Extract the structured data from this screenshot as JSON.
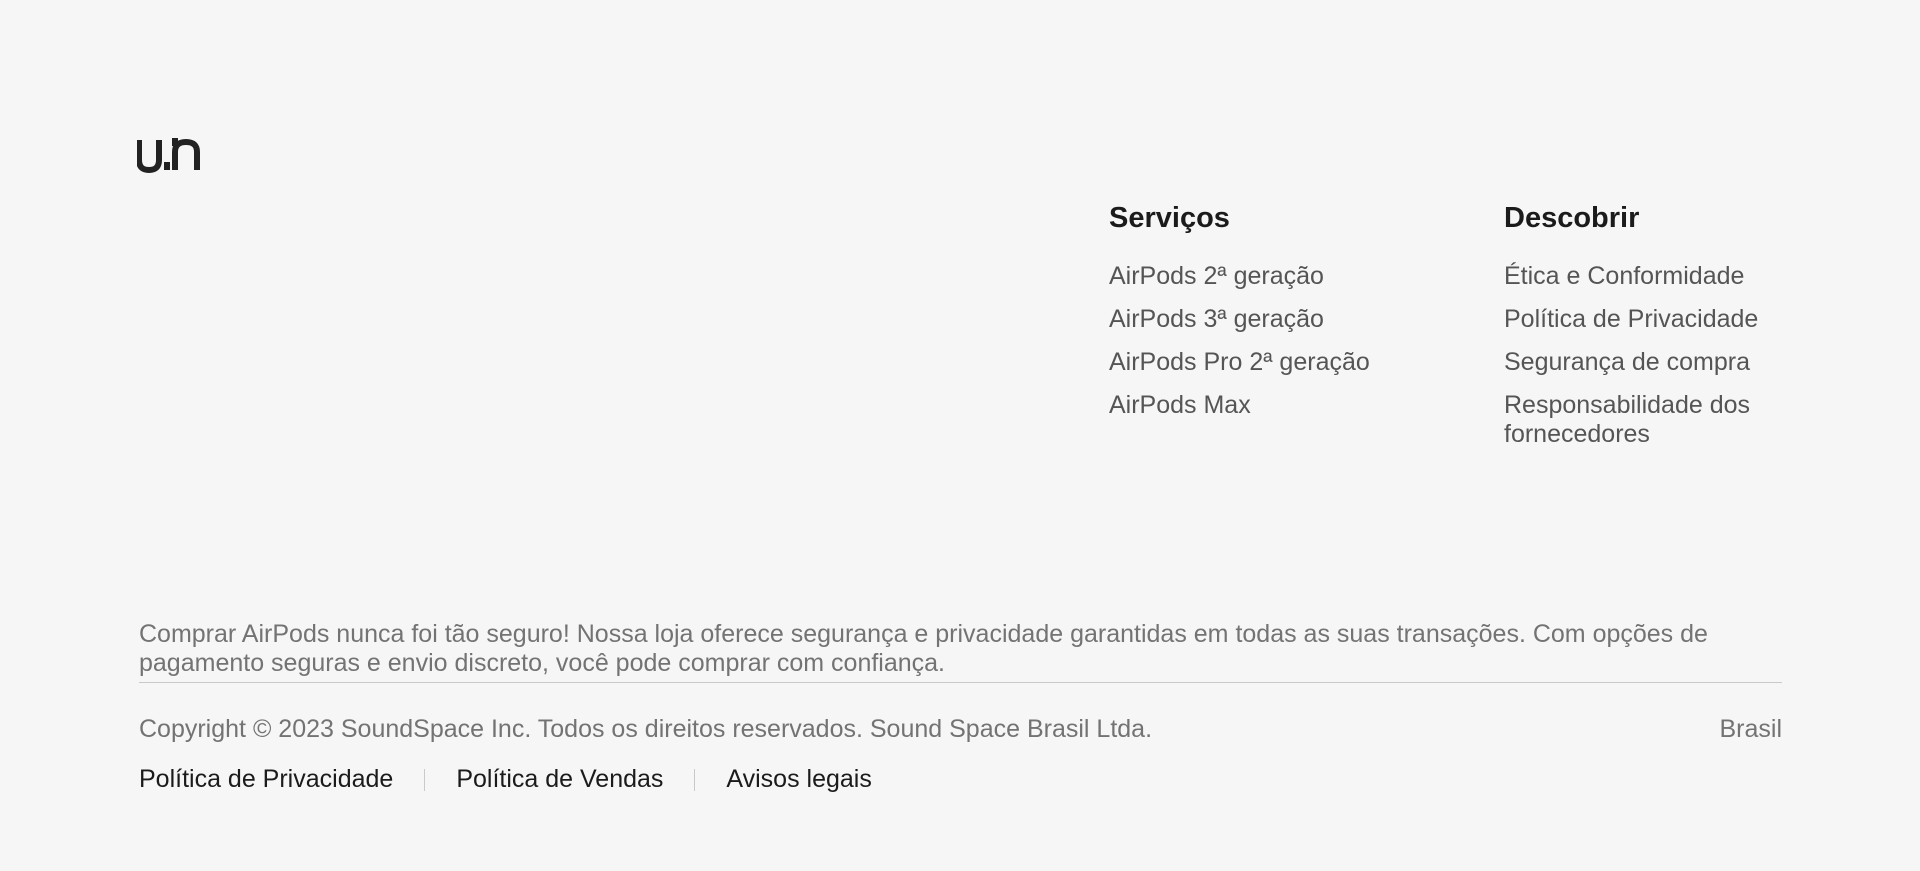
{
  "logo": {
    "alt": "un"
  },
  "columns": {
    "services": {
      "title": "Serviços",
      "items": [
        "AirPods 2ª geração",
        "AirPods 3ª geração",
        "AirPods Pro 2ª geração",
        "AirPods Max"
      ]
    },
    "discover": {
      "title": "Descobrir",
      "items": [
        "Ética e Conformidade",
        "Política de Privacidade",
        "Segurança de compra",
        "Responsabilidade dos fornecedores"
      ]
    }
  },
  "description": "Comprar AirPods nunca foi tão seguro! Nossa loja oferece segurança e privacidade garantidas em todas as suas transações. Com opções de pagamento seguras e envio discreto, você pode comprar com confiança.",
  "copyright": "Copyright © 2023 SoundSpace Inc. Todos os direitos reservados. Sound Space Brasil Ltda.",
  "region": "Brasil",
  "legal_links": [
    "Política de Privacidade",
    "Política de Vendas",
    "Avisos legais"
  ],
  "colors": {
    "background": "#f6f6f6",
    "heading": "#1b1b1b",
    "link": "#555555",
    "muted": "#737373",
    "divider": "#c9c9c9"
  }
}
